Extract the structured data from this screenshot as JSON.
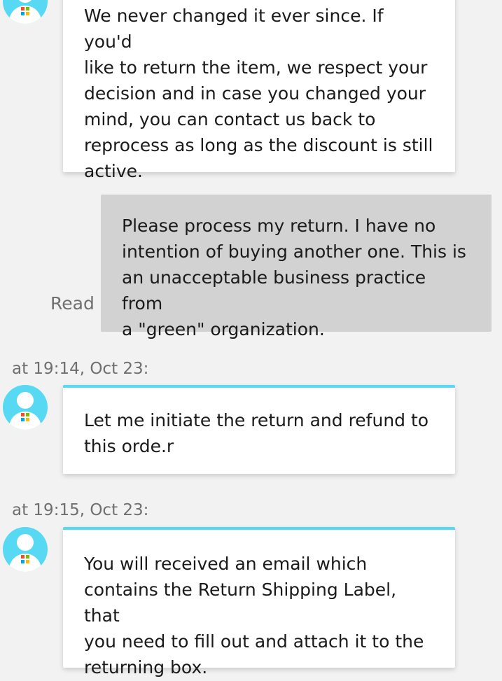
{
  "messages": [
    {
      "sender": "agent",
      "text": "We never changed it ever since. If you'd\nlike to return the item, we respect your\ndecision and in case you changed your\nmind, you can contact us back to\nreprocess as long as the discount is still\nactive."
    },
    {
      "sender": "user",
      "status": "Read",
      "text": "Please process my return. I have no\nintention of buying another one. This is\nan unacceptable business practice from\na \"green\" organization."
    },
    {
      "sender": "agent",
      "timestamp": "at 19:14, Oct 23:",
      "text": "Let me initiate the return and refund to\nthis orde.r"
    },
    {
      "sender": "agent",
      "timestamp": "at 19:15, Oct 23:",
      "text": "You will received an email which\ncontains the Return Shipping Label, that\nyou need to fill out and attach it to the\nreturning box."
    }
  ],
  "colors": {
    "background": "#f2f2f2",
    "agent_bubble": "#ffffff",
    "user_bubble": "#d2d2d2",
    "accent": "#57d8f3",
    "meta_text": "#6f6f6f"
  },
  "icons": {
    "agent_avatar": "agent-avatar-icon",
    "brand_logo": "windows-logo-icon"
  }
}
